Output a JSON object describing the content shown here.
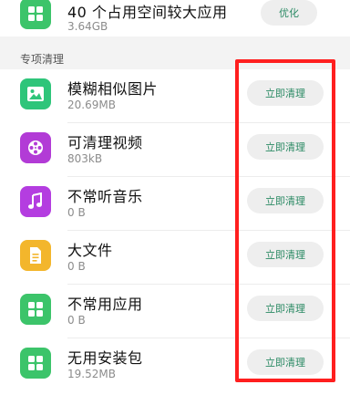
{
  "top_item": {
    "title": "40 个占用空间较大应用",
    "size": "3.64GB",
    "button_label": "优化",
    "icon": "apps-grid-icon",
    "icon_color": "#3cc46a"
  },
  "section": {
    "title": "专项清理"
  },
  "items": [
    {
      "title": "模糊相似图片",
      "size": "20.69MB",
      "button_label": "立即清理",
      "icon": "image-icon",
      "icon_color": "#2ec57a"
    },
    {
      "title": "可清理视频",
      "size": "803kB",
      "button_label": "立即清理",
      "icon": "film-reel-icon",
      "icon_color": "#b23bd6"
    },
    {
      "title": "不常听音乐",
      "size": "0 B",
      "button_label": "立即清理",
      "icon": "music-note-icon",
      "icon_color": "#b43de0"
    },
    {
      "title": "大文件",
      "size": "0 B",
      "button_label": "立即清理",
      "icon": "document-icon",
      "icon_color": "#f3b62c"
    },
    {
      "title": "不常用应用",
      "size": "0 B",
      "button_label": "立即清理",
      "icon": "apps-grid-icon",
      "icon_color": "#3cc46a"
    },
    {
      "title": "无用安装包",
      "size": "19.52MB",
      "button_label": "立即清理",
      "icon": "apps-grid-icon",
      "icon_color": "#3cc46a"
    }
  ],
  "colors": {
    "accent_text": "#2b8a64",
    "highlight": "#ff1f1f"
  }
}
